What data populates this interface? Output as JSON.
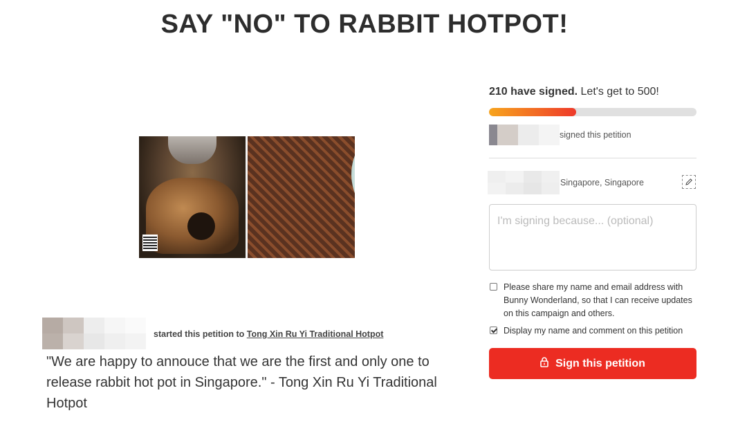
{
  "page": {
    "title": "SAY \"NO\" TO RABBIT HOTPOT!"
  },
  "petition": {
    "image_alt_name": "hotpot-photo",
    "starter_text": "started this petition to",
    "target_name": "Tong Xin Ru Yi Traditional Hotpot",
    "quote": "\"We are happy to annouce that we are the first and only one to release rabbit hot pot in Singapore.\" - Tong Xin Ru Yi Traditional Hotpot"
  },
  "sign_panel": {
    "signed_count_bold": "210 have signed.",
    "goal_text": "Let's get to 500!",
    "signed": 210,
    "goal": 500,
    "progress_fraction": 0.42,
    "signed_this_petition": "signed this petition",
    "location": "Singapore, Singapore",
    "comment_placeholder": "I'm signing because... (optional)",
    "checkbox_share": {
      "label": "Please share my name and email address with Bunny Wonderland, so that I can receive updates on this campaign and others.",
      "checked": false
    },
    "checkbox_display": {
      "label": "Display my name and comment on this petition",
      "checked": true
    },
    "sign_button_label": "Sign this petition"
  },
  "colors": {
    "accent": "#ec2c22",
    "progress_start": "#f7a41d",
    "progress_end": "#ee3a2a"
  },
  "icons": {
    "lock": "lock-icon",
    "edit": "edit-icon"
  }
}
